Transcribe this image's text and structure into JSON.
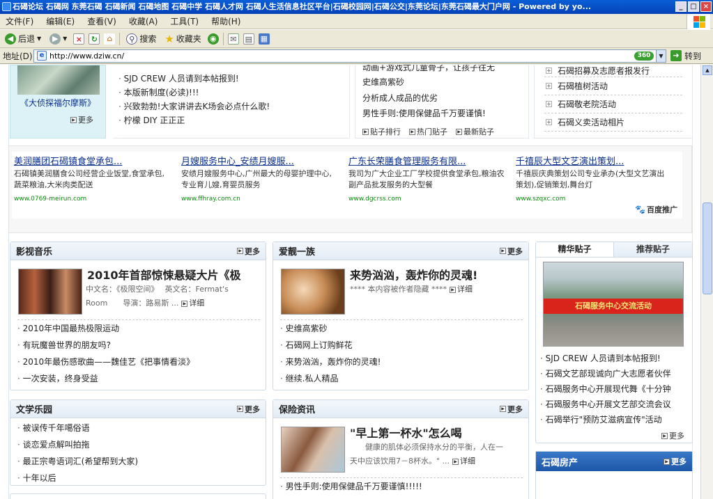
{
  "window": {
    "title": "石碣论坛 石碣网 东莞石碣 石碣新闻 石碣地图 石碣中学 石碣人才网 石碣人生活信息社区平台|石碣校园网|石碣公交|东莞论坛|东莞石碣最大门户网 - Powered by yo..."
  },
  "menu": [
    "文件(F)",
    "编辑(E)",
    "查看(V)",
    "收藏(A)",
    "工具(T)",
    "帮助(H)"
  ],
  "toolbar": {
    "back": "后退",
    "search": "搜索",
    "favorites": "收藏夹"
  },
  "address": {
    "label": "地址(D)",
    "url": "http://www.dziw.cn/",
    "badge": "360",
    "go": "转到"
  },
  "top": {
    "movie_caption": "《大侦探福尔摩斯》",
    "more": "更多",
    "left_list": [
      "SJD CREW 人员请到本帖报到!",
      "本版新制度(必读)!!!",
      "兴致勃勃!大家讲讲去K场会必点什么歌!",
      "柠檬 DIY 正正正"
    ],
    "mid_list": [
      "动画+游戏式儿童骨子，让孩子往无",
      "史维高紫砂",
      "分析成人成品的优劣",
      "男性手则:使用保健品千万要谨慎!"
    ],
    "mid_tabs": [
      "贴子排行",
      "热门贴子",
      "最新贴子"
    ],
    "right_list": [
      "石碣招募及志愿者报发行",
      "石碣植树活动",
      "石碣敬老院活动",
      "石碣义卖活动相片"
    ]
  },
  "ads": [
    {
      "title": "美润膳团石碣镇食堂承包...",
      "desc": "石碣镇美润膳食公司经营企业饭堂,食堂承包,蔬菜粮油,大米肉类配送",
      "url": "www.0769-meirun.com"
    },
    {
      "title": "月嫂服务中心_安绩月嫂服...",
      "desc": "安绩月嫂服务中心,广州最大的母婴护理中心,专业育儿嫂,育婴员服务",
      "url": "www.ffhray.com.cn"
    },
    {
      "title": "广东长荣膳食管理服务有限...",
      "desc": "我司为广大企业工厂学校提供食堂承包,粮油农副产品批发服务的大型餐",
      "url": "www.dgcrss.com"
    },
    {
      "title": "千禧辰大型文艺演出策划...",
      "desc": "千禧辰庆典策划公司专业承办(大型文艺演出策划),促销策划,舞台灯",
      "url": "www.szqxc.com"
    }
  ],
  "baidu": "百度推广",
  "yingshi": {
    "title": "影视音乐",
    "more": "更多",
    "feat_title": "2010年首部惊悚悬疑大片《极",
    "feat_l1": "中文名：《极限空间》　 英文名：Fermat's",
    "feat_l2": "Room　　导演：路易斯 ...",
    "detail": "详细",
    "list": [
      "2010年中国最热极限运动",
      "有玩魔兽世界的朋友吗?",
      "2010年最伤感歌曲——魏佳艺《把事情看淡》",
      "一次安装，终身受益"
    ]
  },
  "aili": {
    "title": "爱靓一族",
    "more": "更多",
    "feat_title": "来势汹汹，轰炸你的灵魂!",
    "feat_l1": "**** 本内容被作者隐藏 ****",
    "detail": "详细",
    "list": [
      "史维高紫砂",
      "石碣网上订购鲜花",
      "来势汹汹，轰炸你的灵魂!",
      "继续.私人精品"
    ]
  },
  "jinghua": {
    "tab_active": "精华贴子",
    "tab_other": "推荐贴子",
    "list": [
      "SJD CREW 人员请到本帖报到!",
      "石碣文艺部现诚向广大志愿者伙伴",
      "石碣服务中心开展现代舞《十分钟",
      "石碣服务中心开展文艺部交流会议",
      "石碣举行\"预防艾滋病宣传\"活动"
    ],
    "more": "更多",
    "banner_text": "石碣服务中心交流活动"
  },
  "wenxue": {
    "title": "文学乐园",
    "more": "更多",
    "list": [
      "被误传千年噶俗语",
      "谈恋爱点解叫拍拖",
      "最正宗粤语词汇(希望帮到大家)",
      "十年以后"
    ]
  },
  "baoxian": {
    "title": "保险资讯",
    "more": "更多",
    "feat_title": "\"早上第一杯水\"怎么喝",
    "feat_l1": "　　健康的肌体必须保持水分的平衡，人在一",
    "feat_l2": "天中应该饮用7－8杯水。\" ...",
    "detail": "详细",
    "list": [
      "男性手则:使用保健品千万要谨慎!!!!!"
    ]
  },
  "fangchan": {
    "title": "石碣房产",
    "more": "更多"
  }
}
